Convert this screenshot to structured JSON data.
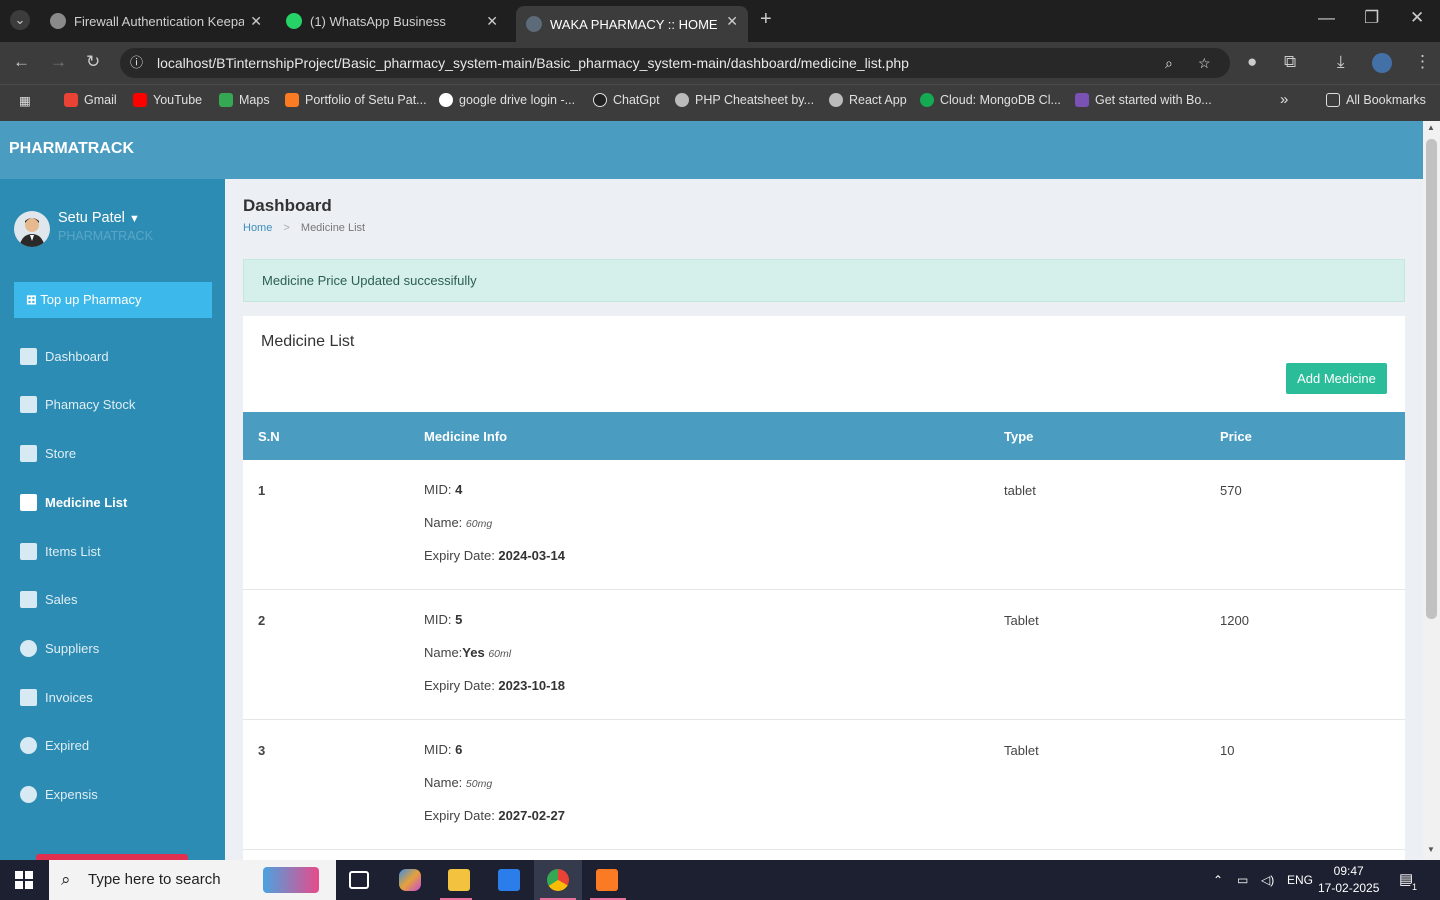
{
  "browser": {
    "tabs": [
      {
        "title": "Firewall Authentication Keepaliv",
        "icon": "globe-icon"
      },
      {
        "title": "(1) WhatsApp Business",
        "icon": "whatsapp-icon"
      },
      {
        "title": "WAKA PHARMACY :: HOME",
        "icon": "pharmacy-icon"
      }
    ],
    "new_tab": "+",
    "url": "localhost/BTinternshipProject/Basic_pharmacy_system-main/Basic_pharmacy_system-main/dashboard/medicine_list.php",
    "bookmarks": [
      "Gmail",
      "YouTube",
      "Maps",
      "Portfolio of Setu Pat...",
      "google drive login -...",
      "ChatGpt",
      "PHP Cheatsheet by...",
      "React App",
      "Cloud: MongoDB Cl...",
      "Get started with Bo..."
    ],
    "bookmarks_more": "»",
    "all_bookmarks": "All Bookmarks"
  },
  "app": {
    "brand": "PHARMATRACK",
    "user": {
      "name": "Setu Patel",
      "role": "PHARMATRACK"
    },
    "topup_label": "Top up Pharmacy",
    "nav": [
      {
        "label": "Dashboard",
        "icon": "dashboard-icon"
      },
      {
        "label": "Phamacy Stock",
        "icon": "clipboard-icon"
      },
      {
        "label": "Store",
        "icon": "home-icon"
      },
      {
        "label": "Medicine List",
        "icon": "clipboard-icon"
      },
      {
        "label": "Items List",
        "icon": "clipboard-icon"
      },
      {
        "label": "Sales",
        "icon": "money-icon"
      },
      {
        "label": "Suppliers",
        "icon": "user-icon"
      },
      {
        "label": "Invoices",
        "icon": "money-icon"
      },
      {
        "label": "Expired",
        "icon": "gear-icon"
      },
      {
        "label": "Expensis",
        "icon": "gear-icon"
      }
    ],
    "active_nav": "Medicine List"
  },
  "page": {
    "title": "Dashboard",
    "breadcrumb": [
      "Home",
      "Medicine List"
    ],
    "alert": "Medicine Price Updated successifully",
    "box_title": "Medicine List",
    "add_button": "Add Medicine",
    "columns": [
      "S.N",
      "Medicine Info",
      "Type",
      "Price"
    ],
    "labels": {
      "mid": "MID: ",
      "name": "Name: ",
      "name_tight": "Name:",
      "expiry": "Expiry Date: "
    },
    "rows": [
      {
        "sn": "1",
        "mid": "4",
        "name": "",
        "dose": "60mg",
        "expiry": "2024-03-14",
        "type": "tablet",
        "price": "570"
      },
      {
        "sn": "2",
        "mid": "5",
        "name": "Yes",
        "dose": "60ml",
        "expiry": "2023-10-18",
        "type": "Tablet",
        "price": "1200"
      },
      {
        "sn": "3",
        "mid": "6",
        "name": "",
        "dose": "50mg",
        "expiry": "2027-02-27",
        "type": "Tablet",
        "price": "10"
      }
    ]
  },
  "taskbar": {
    "search_placeholder": "Type here to search",
    "lang": "ENG",
    "time": "09:47",
    "date": "17-02-2025",
    "notifications": "1"
  }
}
